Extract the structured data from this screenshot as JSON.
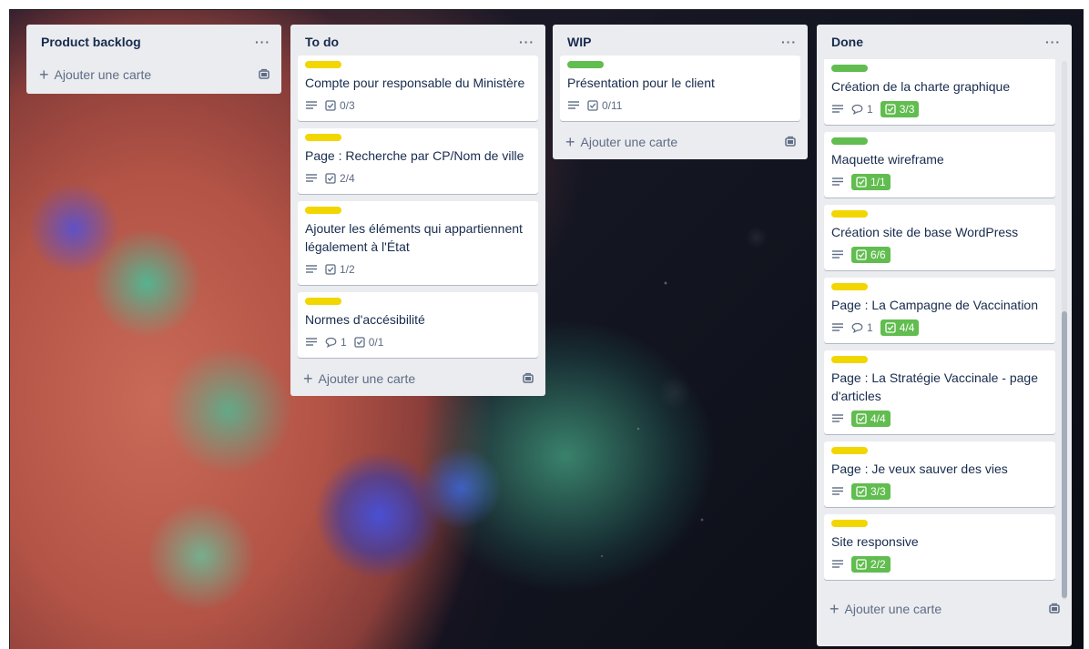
{
  "lists": {
    "backlog": {
      "title": "Product backlog",
      "add_label": "Ajouter une carte"
    },
    "todo": {
      "title": "To do",
      "add_label": "Ajouter une carte",
      "cards": [
        {
          "title": "Compte pour responsable du Ministère",
          "label": "yellow",
          "checklist": "0/3"
        },
        {
          "title": "Page : Recherche par CP/Nom de ville",
          "label": "yellow",
          "checklist": "2/4"
        },
        {
          "title": "Ajouter les éléments qui appartiennent légalement à l'État",
          "label": "yellow",
          "checklist": "1/2"
        },
        {
          "title": "Normes d'accésibilité",
          "label": "yellow",
          "comments": "1",
          "checklist": "0/1"
        }
      ]
    },
    "wip": {
      "title": "WIP",
      "add_label": "Ajouter une carte",
      "cards": [
        {
          "title": "Présentation pour le client",
          "label": "green",
          "checklist": "0/11"
        }
      ]
    },
    "done": {
      "title": "Done",
      "add_label": "Ajouter une carte",
      "cards": [
        {
          "title": "Création de la charte graphique",
          "label": "green",
          "comments": "1",
          "checklist": "3/3"
        },
        {
          "title": "Maquette wireframe",
          "label": "green",
          "checklist": "1/1"
        },
        {
          "title": "Création site de base WordPress",
          "label": "yellow",
          "checklist": "6/6"
        },
        {
          "title": "Page : La Campagne de Vaccination",
          "label": "yellow",
          "comments": "1",
          "checklist": "4/4"
        },
        {
          "title": "Page : La Stratégie Vaccinale - page d'articles",
          "label": "yellow",
          "checklist": "4/4"
        },
        {
          "title": "Page : Je veux sauver des vies",
          "label": "yellow",
          "checklist": "3/3"
        },
        {
          "title": "Site responsive",
          "label": "yellow",
          "checklist": "2/2"
        }
      ],
      "scroll_position": 0.46
    }
  },
  "menu_glyph": "···",
  "add_glyph": "+",
  "colors": {
    "list_bg": "#ebecf0",
    "label_yellow": "#f2d600",
    "label_green": "#61bd4f",
    "text": "#172b4d",
    "muted": "#5e6c84"
  },
  "icons": [
    "description-icon",
    "comment-icon",
    "checklist-icon",
    "card-template-icon",
    "more-icon",
    "plus-icon"
  ]
}
